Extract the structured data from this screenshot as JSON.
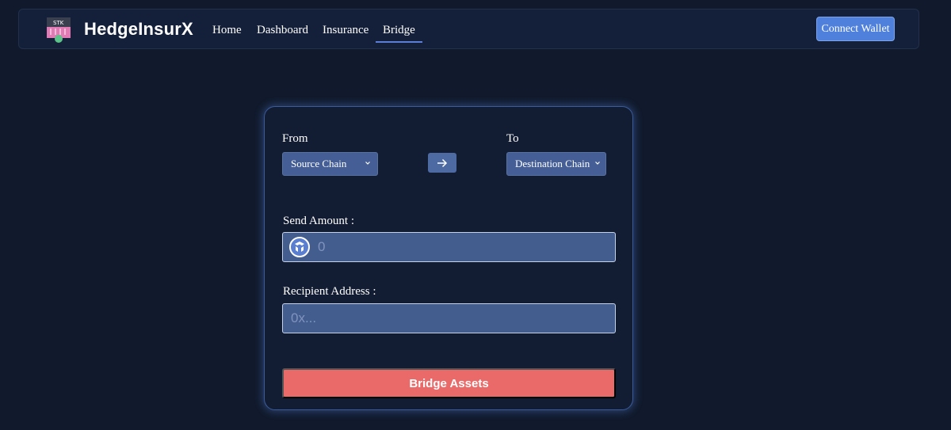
{
  "header": {
    "logo_text": "STK",
    "brand": "HedgeInsurX",
    "nav": [
      {
        "label": "Home",
        "active": false
      },
      {
        "label": "Dashboard",
        "active": false
      },
      {
        "label": "Insurance",
        "active": false
      },
      {
        "label": "Bridge",
        "active": true
      }
    ],
    "connect_label": "Connect Wallet"
  },
  "bridge": {
    "from_label": "From",
    "to_label": "To",
    "source_chain": "Source Chain",
    "destination_chain": "Destination Chain",
    "arrow_icon": "arrow-right-icon",
    "send_amount_label": "Send Amount :",
    "amount_placeholder": "0",
    "token_icon": "token-icon",
    "recipient_label": "Recipient Address :",
    "recipient_placeholder": "0x...",
    "submit_label": "Bridge Assets"
  },
  "colors": {
    "background": "#111a2c",
    "navbar": "#142039",
    "accent": "#4e80dc",
    "input": "#445d8f",
    "submit": "#e96a69"
  }
}
